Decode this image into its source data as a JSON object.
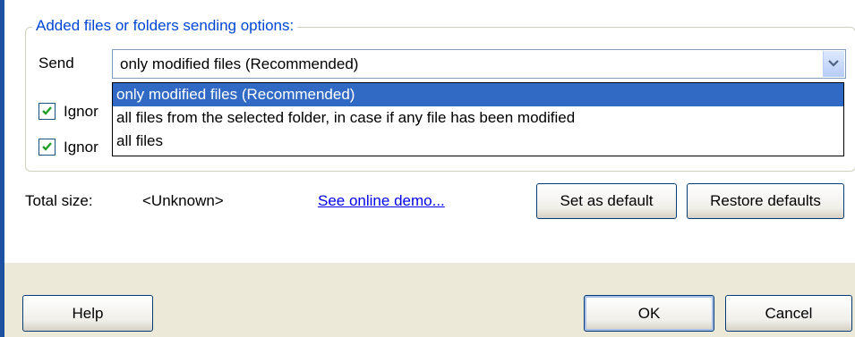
{
  "group": {
    "title": "Added files or folders sending options:"
  },
  "send": {
    "label": "Send",
    "selected": "only modified files (Recommended)",
    "options": [
      "only modified files (Recommended)",
      "all files from the selected folder, in case if any file has been modified",
      "all files"
    ]
  },
  "checkboxes": [
    {
      "label": "Ignor",
      "checked": true
    },
    {
      "label": "Ignor",
      "checked": true
    }
  ],
  "info": {
    "total_label": "Total size:",
    "total_value": "<Unknown>",
    "demo_link": "See online demo..."
  },
  "buttons": {
    "set_default": "Set as default",
    "restore_defaults": "Restore defaults",
    "help": "Help",
    "ok": "OK",
    "cancel": "Cancel"
  },
  "colors": {
    "group_title": "#0046d5",
    "selection": "#316ac5",
    "link": "#0000ee",
    "window_edge": "#1e50a2"
  },
  "icons": {
    "dropdown_arrow": "chevron-down-icon",
    "checkbox_check": "checkmark-icon"
  }
}
